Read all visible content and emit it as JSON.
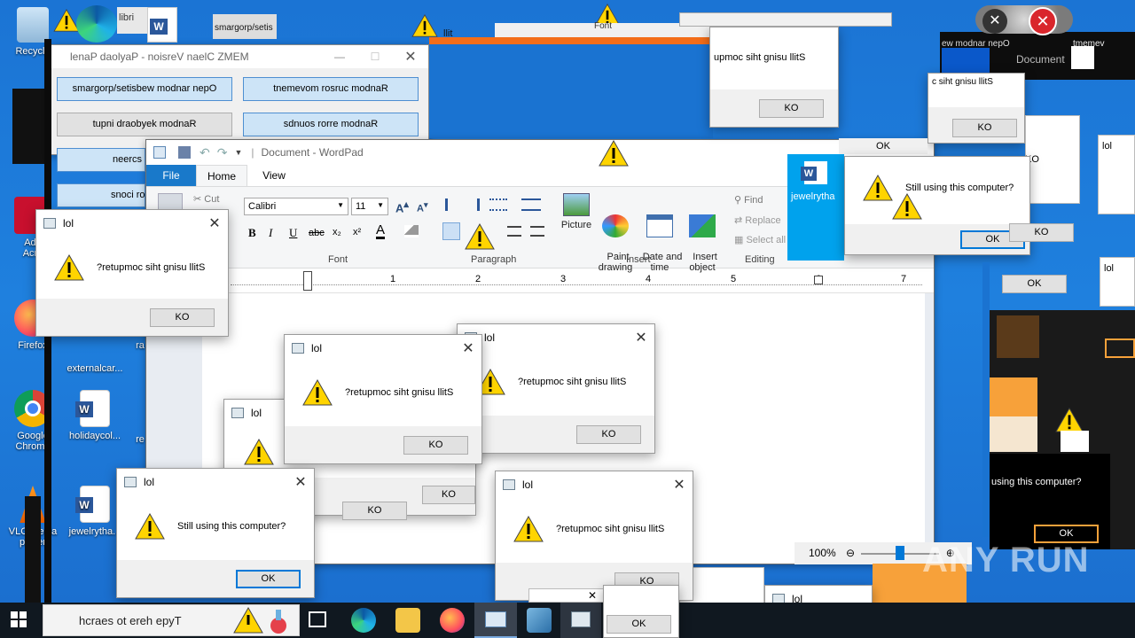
{
  "desktop_icons": [
    {
      "label": "Recycle",
      "name": "recycle-bin"
    },
    {
      "label": "Add\nAcro",
      "name": "acrobat"
    },
    {
      "label": "Firefox",
      "name": "firefox"
    },
    {
      "label": "externalcar...",
      "name": "externalcar"
    },
    {
      "label": "Google\nChrome",
      "name": "chrome"
    },
    {
      "label": "holidaycol...",
      "name": "holidaycol"
    },
    {
      "label": "VLC media\nplayer",
      "name": "vlc"
    },
    {
      "label": "jewelrytha...",
      "name": "jewelrytha"
    },
    {
      "label": "jewelrytha",
      "name": "jewelrytha-2"
    },
    {
      "label": "libri",
      "name": "libri"
    },
    {
      "label": "smargorp/setisi",
      "name": "setisi"
    },
    {
      "label": "re",
      "name": "re"
    },
    {
      "label": "ra",
      "name": "ra"
    }
  ],
  "memz_panel": {
    "title": "lenaP daolyaP - noisreV naelC ZMEM",
    "buttons": [
      "smargorp/setisbew modnar nepO",
      "tnemevom rosruc modnaR",
      "tupni draobyek modnaR",
      "sdnuos rorre modnaR",
      "neercs c",
      "snoci ro"
    ]
  },
  "wordpad": {
    "title": "Document - WordPad",
    "tabs": [
      "File",
      "Home",
      "View"
    ],
    "clipboard": {
      "cut": "Cut"
    },
    "font_name": "Calibri",
    "font_size": "11",
    "groups": {
      "font": "Font",
      "paragraph": "Paragraph",
      "insert": "Insert",
      "editing": "Editing"
    },
    "insert_buttons": [
      "Picture",
      "Paint\ndrawing",
      "Date and\ntime",
      "Insert\nobject"
    ],
    "editing_items": [
      "Find",
      "Replace",
      "Select all"
    ],
    "ruler_numbers": [
      "1",
      "2",
      "3",
      "4",
      "5",
      "6",
      "7"
    ],
    "zoom": "100%"
  },
  "dialogs": [
    {
      "title": "lol",
      "message": "?retupmoc siht gnisu llitS",
      "ok": "KO"
    },
    {
      "title": "lol",
      "message": "?retupmoc siht gnisu llitS",
      "ok": "KO"
    },
    {
      "title": "lol",
      "message": "?retupmoc siht gnisu llitS",
      "ok": "KO"
    },
    {
      "title": "lol",
      "message": "",
      "ok": "KO"
    },
    {
      "title": "lol",
      "message": "Still using this computer?",
      "ok": "OK"
    },
    {
      "title": "lol",
      "message": "?retupmoc siht gnisu llitS",
      "ok": "KO"
    },
    {
      "title": "lol",
      "message": "",
      "ok": "OK"
    },
    {
      "title": "lol",
      "message": "",
      "ok": "KO"
    }
  ],
  "fragments": {
    "top_dialog_msg": "upmoc siht gnisu llitS",
    "top_ok": "KO",
    "still_top_right": "Still using this computer?",
    "still_bottom_right": "using this computer?",
    "ok_labels": [
      "OK",
      "OK",
      "KO",
      "OK",
      "KO",
      "KO",
      "OK",
      "OK",
      "KO",
      "OK"
    ],
    "top_right_title": "ew modnar nepO",
    "document_tab": "Document",
    "tmemev": "tmemev",
    "jewelrytha_word": "jewelrytha",
    "llitS_frag": "c siht gnisu llitS",
    "fonts_frag": "Font",
    "top_setis": "smargorp/setis",
    "llit": "llit",
    "libri": "libri"
  },
  "taskbar": {
    "search_placeholder": "hcraes ot ereh epyT"
  },
  "watermark": "ANY RUN",
  "colors": {
    "desktop": "#1b74d4",
    "ribbon_file": "#1979ca",
    "focus_blue": "#0078d7",
    "warning_yellow": "#ffd400",
    "orange": "#f7a13a"
  }
}
